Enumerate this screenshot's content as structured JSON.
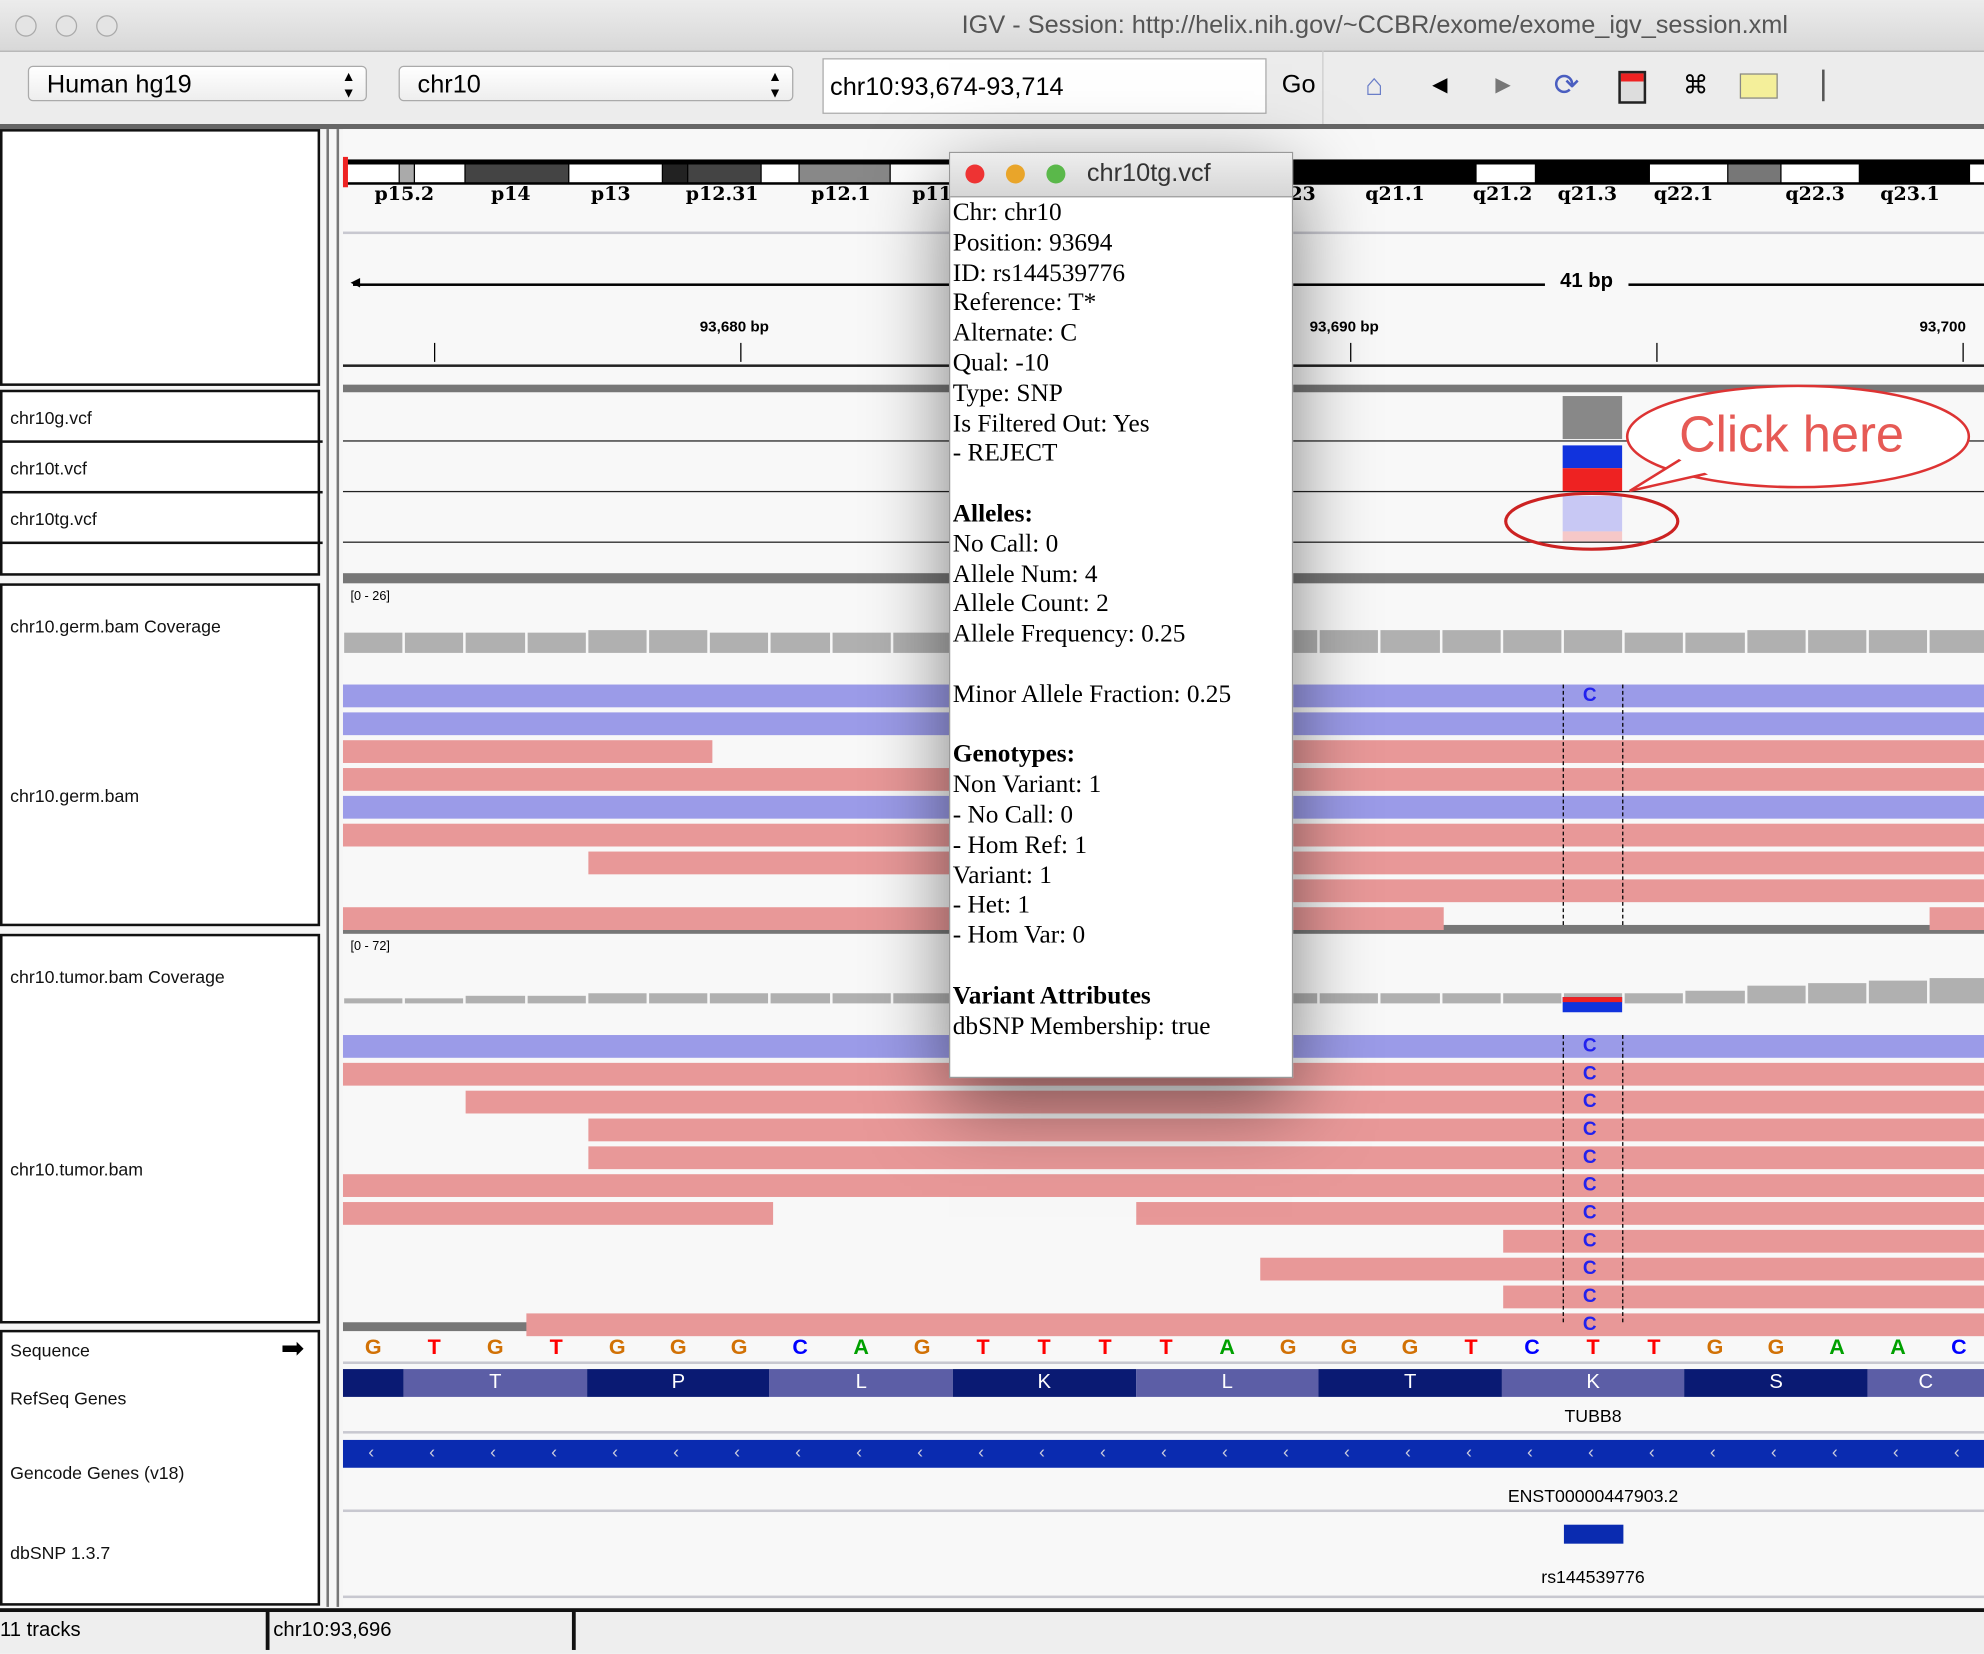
{
  "window": {
    "title": "IGV - Session: http://helix.nih.gov/~CCBR/exome/exome_igv_session.xml"
  },
  "toolbar": {
    "genome": "Human hg19",
    "chromosome": "chr10",
    "locus": "chr10:93,674-93,714",
    "go_label": "Go",
    "icons": [
      "home-icon",
      "back-icon",
      "forward-icon",
      "refresh-icon",
      "roi-icon",
      "fit-icon",
      "popup-info-icon"
    ]
  },
  "ruler": {
    "bands": [
      "p15.2",
      "p14",
      "p13",
      "p12.31",
      "p12.1",
      "p11",
      "23",
      "q21.1",
      "q21.2",
      "q21.3",
      "q22.1",
      "q22.3",
      "q23.1"
    ],
    "span": "41 bp",
    "ticks": [
      "93,680 bp",
      "93,690 bp",
      "93,700"
    ]
  },
  "tracks": {
    "vcf": [
      "chr10g.vcf",
      "chr10t.vcf",
      "chr10tg.vcf"
    ],
    "germ_coverage": "chr10.germ.bam Coverage",
    "germ_range": "[0 - 26]",
    "germ_bam": "chr10.germ.bam",
    "tumor_coverage": "chr10.tumor.bam Coverage",
    "tumor_range": "[0 - 72]",
    "tumor_bam": "chr10.tumor.bam",
    "sequence": "Sequence",
    "refseq": "RefSeq Genes",
    "gencode": "Gencode Genes (v18)",
    "dbsnp": "dbSNP 1.3.7",
    "mismatch_base": "C"
  },
  "sequence": [
    "G",
    "T",
    "G",
    "T",
    "G",
    "G",
    "G",
    "C",
    "A",
    "G",
    "T",
    "T",
    "T",
    "T",
    "A",
    "G",
    "G",
    "G",
    "T",
    "C",
    "T",
    "T",
    "G",
    "G",
    "A",
    "A",
    "C"
  ],
  "amino_acids": [
    "",
    "T",
    "P",
    "L",
    "K",
    "L",
    "T",
    "K",
    "S",
    "C"
  ],
  "features": {
    "refseq_gene": "TUBB8",
    "gencode_transcript": "ENST00000447903.2",
    "dbsnp_id": "rs144539776"
  },
  "colors": {
    "A": "#00a000",
    "C": "#0000ff",
    "G": "#d17105",
    "T": "#ff0000",
    "forward_read": "#9b9be8",
    "reverse_read": "#e89898",
    "coverage": "#b0b0b0",
    "gene": "#0a2bb0"
  },
  "popup": {
    "title": "chr10tg.vcf",
    "lines": [
      "Chr: chr10",
      "Position: 93694",
      "ID: rs144539776",
      "Reference: T*",
      "Alternate: C",
      "Qual: -10",
      "Type: SNP",
      "Is Filtered Out: Yes",
      "- REJECT",
      "",
      "Alleles:",
      "No Call: 0",
      "Allele Num: 4",
      "Allele Count: 2",
      "Allele Frequency: 0.25",
      "",
      "Minor Allele Fraction: 0.25",
      "",
      "Genotypes:",
      "Non Variant: 1",
      "- No Call: 0",
      "- Hom Ref: 1",
      "Variant: 1",
      "- Het: 1",
      "- Hom Var: 0",
      "",
      "Variant Attributes",
      "dbSNP Membership: true"
    ],
    "bold_lines": [
      10,
      18,
      26
    ]
  },
  "annotation": {
    "callout": "Click here"
  },
  "status": {
    "tracks": "11 tracks",
    "position": "chr10:93,696"
  }
}
